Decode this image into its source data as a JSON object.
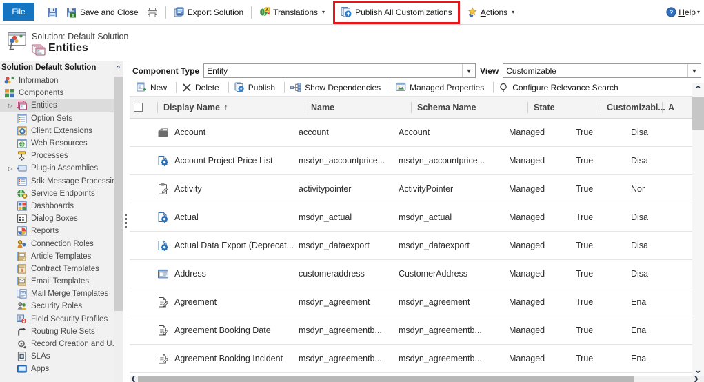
{
  "topbar": {
    "file_label": "File",
    "commands": [
      {
        "name": "save",
        "label": "",
        "icon": "save-icon"
      },
      {
        "name": "save-and-close",
        "label": "Save and Close",
        "icon": "save-close-icon"
      },
      {
        "name": "print",
        "label": "",
        "icon": "print-icon"
      },
      {
        "name": "export-solution",
        "label": "Export Solution",
        "icon": "export-icon"
      },
      {
        "name": "translations",
        "label": "Translations",
        "icon": "translations-icon",
        "caret": "▾"
      },
      {
        "name": "publish-all-customizations",
        "label": "Publish All Customizations",
        "icon": "publish-icon"
      },
      {
        "name": "actions",
        "label": "Actions",
        "icon": "actions-icon",
        "caret": "▾"
      }
    ],
    "help_label": "Help",
    "help_caret": "▾",
    "highlight_color": "#e8151b",
    "file_tab_color": "#1675c0"
  },
  "title": {
    "solution_label": "Solution: Default Solution",
    "entity_title": "Entities"
  },
  "sidebar": {
    "header": "Solution Default Solution",
    "scroll_up_chevron": "⌃",
    "items": [
      {
        "label": "Information",
        "icon": "information-icon",
        "level": 0,
        "twisty": "",
        "selected": false
      },
      {
        "label": "Components",
        "icon": "components-icon",
        "level": 0,
        "twisty": "",
        "selected": false
      },
      {
        "label": "Entities",
        "icon": "entities-icon",
        "level": 1,
        "twisty": "▷",
        "selected": true
      },
      {
        "label": "Option Sets",
        "icon": "option-sets-icon",
        "level": 1,
        "twisty": "",
        "selected": false
      },
      {
        "label": "Client Extensions",
        "icon": "client-extensions-icon",
        "level": 1,
        "twisty": "",
        "selected": false
      },
      {
        "label": "Web Resources",
        "icon": "web-resources-icon",
        "level": 1,
        "twisty": "",
        "selected": false
      },
      {
        "label": "Processes",
        "icon": "processes-icon",
        "level": 1,
        "twisty": "",
        "selected": false
      },
      {
        "label": "Plug-in Assemblies",
        "icon": "plugin-assemblies-icon",
        "level": 1,
        "twisty": "▷",
        "selected": false
      },
      {
        "label": "Sdk Message Processin...",
        "icon": "sdk-message-icon",
        "level": 1,
        "twisty": "",
        "selected": false
      },
      {
        "label": "Service Endpoints",
        "icon": "service-endpoints-icon",
        "level": 1,
        "twisty": "",
        "selected": false
      },
      {
        "label": "Dashboards",
        "icon": "dashboards-icon",
        "level": 1,
        "twisty": "",
        "selected": false
      },
      {
        "label": "Dialog Boxes",
        "icon": "dialog-boxes-icon",
        "level": 1,
        "twisty": "",
        "selected": false
      },
      {
        "label": "Reports",
        "icon": "reports-icon",
        "level": 1,
        "twisty": "",
        "selected": false
      },
      {
        "label": "Connection Roles",
        "icon": "connection-roles-icon",
        "level": 1,
        "twisty": "",
        "selected": false
      },
      {
        "label": "Article Templates",
        "icon": "article-templates-icon",
        "level": 1,
        "twisty": "",
        "selected": false
      },
      {
        "label": "Contract Templates",
        "icon": "contract-templates-icon",
        "level": 1,
        "twisty": "",
        "selected": false
      },
      {
        "label": "Email Templates",
        "icon": "email-templates-icon",
        "level": 1,
        "twisty": "",
        "selected": false
      },
      {
        "label": "Mail Merge Templates",
        "icon": "mail-merge-templates-icon",
        "level": 1,
        "twisty": "",
        "selected": false
      },
      {
        "label": "Security Roles",
        "icon": "security-roles-icon",
        "level": 1,
        "twisty": "",
        "selected": false
      },
      {
        "label": "Field Security Profiles",
        "icon": "field-security-profiles-icon",
        "level": 1,
        "twisty": "",
        "selected": false
      },
      {
        "label": "Routing Rule Sets",
        "icon": "routing-rule-sets-icon",
        "level": 1,
        "twisty": "",
        "selected": false
      },
      {
        "label": "Record Creation and U...",
        "icon": "record-creation-icon",
        "level": 1,
        "twisty": "",
        "selected": false
      },
      {
        "label": "SLAs",
        "icon": "slas-icon",
        "level": 1,
        "twisty": "",
        "selected": false
      },
      {
        "label": "Apps",
        "icon": "apps-icon",
        "level": 1,
        "twisty": "",
        "selected": false
      }
    ]
  },
  "filters": {
    "component_type_label": "Component Type",
    "component_type_value": "Entity",
    "view_label": "View",
    "view_value": "Customizable",
    "dropdown_glyph": "▼"
  },
  "grid_commands": [
    {
      "name": "new",
      "label": "New",
      "icon": "new-icon"
    },
    {
      "name": "delete",
      "label": "Delete",
      "icon": "delete-x-icon"
    },
    {
      "name": "publish",
      "label": "Publish",
      "icon": "publish-icon"
    },
    {
      "name": "show-dependencies",
      "label": "Show Dependencies",
      "icon": "dependencies-icon"
    },
    {
      "name": "managed-properties",
      "label": "Managed Properties",
      "icon": "managed-properties-icon"
    },
    {
      "name": "configure-relevance-search",
      "label": "Configure Relevance Search",
      "icon": "search-icon"
    }
  ],
  "grid": {
    "columns": [
      {
        "key": "display_name",
        "label": "Display Name",
        "sort": "↑"
      },
      {
        "key": "name",
        "label": "Name",
        "sort": ""
      },
      {
        "key": "schema_name",
        "label": "Schema Name",
        "sort": ""
      },
      {
        "key": "state",
        "label": "State",
        "sort": ""
      },
      {
        "key": "customizable",
        "label": "Customizabl...",
        "sort": ""
      },
      {
        "key": "audit",
        "label": "A",
        "sort": ""
      }
    ],
    "rows": [
      {
        "icon": "entity-record-icon",
        "display_name": "Account",
        "name": "account",
        "schema_name": "Account",
        "state": "Managed",
        "customizable": "True",
        "audit": "Disa"
      },
      {
        "icon": "entity-gear-icon",
        "display_name": "Account Project Price List",
        "name": "msdyn_accountprice...",
        "schema_name": "msdyn_accountprice...",
        "state": "Managed",
        "customizable": "True",
        "audit": "Disa"
      },
      {
        "icon": "entity-activity-icon",
        "display_name": "Activity",
        "name": "activitypointer",
        "schema_name": "ActivityPointer",
        "state": "Managed",
        "customizable": "True",
        "audit": "Nor"
      },
      {
        "icon": "entity-gear-icon",
        "display_name": "Actual",
        "name": "msdyn_actual",
        "schema_name": "msdyn_actual",
        "state": "Managed",
        "customizable": "True",
        "audit": "Disa"
      },
      {
        "icon": "entity-gear-icon",
        "display_name": "Actual Data Export (Deprecat...",
        "name": "msdyn_dataexport",
        "schema_name": "msdyn_dataexport",
        "state": "Managed",
        "customizable": "True",
        "audit": "Disa"
      },
      {
        "icon": "entity-address-icon",
        "display_name": "Address",
        "name": "customeraddress",
        "schema_name": "CustomerAddress",
        "state": "Managed",
        "customizable": "True",
        "audit": "Disa"
      },
      {
        "icon": "entity-doc-pencil-icon",
        "display_name": "Agreement",
        "name": "msdyn_agreement",
        "schema_name": "msdyn_agreement",
        "state": "Managed",
        "customizable": "True",
        "audit": "Ena"
      },
      {
        "icon": "entity-doc-pencil-icon",
        "display_name": "Agreement Booking Date",
        "name": "msdyn_agreementb...",
        "schema_name": "msdyn_agreementb...",
        "state": "Managed",
        "customizable": "True",
        "audit": "Ena"
      },
      {
        "icon": "entity-doc-pencil-icon",
        "display_name": "Agreement Booking Incident",
        "name": "msdyn_agreementb...",
        "schema_name": "msdyn_agreementb...",
        "state": "Managed",
        "customizable": "True",
        "audit": "Ena"
      }
    ]
  },
  "scrollbars": {
    "v_up": "⌃",
    "v_down": "⌄",
    "h_left": "❮",
    "h_right": "❯"
  }
}
